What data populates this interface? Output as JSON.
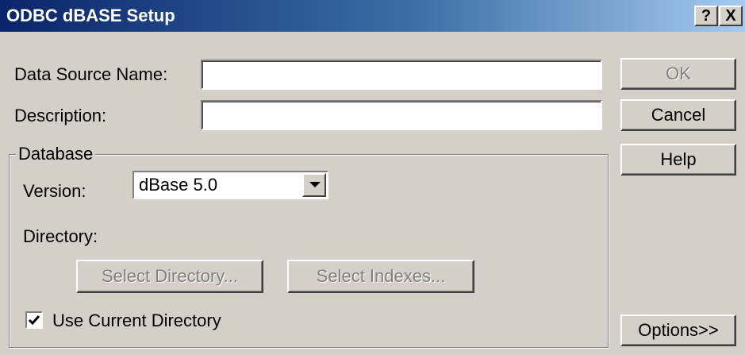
{
  "window": {
    "title": "ODBC dBASE Setup",
    "help_glyph": "?",
    "close_glyph": "X"
  },
  "fields": {
    "data_source_name": {
      "label": "Data Source Name:",
      "value": ""
    },
    "description": {
      "label": "Description:",
      "value": ""
    }
  },
  "database": {
    "group_label": "Database",
    "version_label": "Version:",
    "version_value": "dBase 5.0",
    "directory_label": "Directory:",
    "select_directory_label": "Select Directory...",
    "select_indexes_label": "Select Indexes...",
    "use_current_directory_label": "Use Current Directory",
    "use_current_directory_checked": true
  },
  "buttons": {
    "ok": "OK",
    "cancel": "Cancel",
    "help": "Help",
    "options": "Options>>"
  }
}
